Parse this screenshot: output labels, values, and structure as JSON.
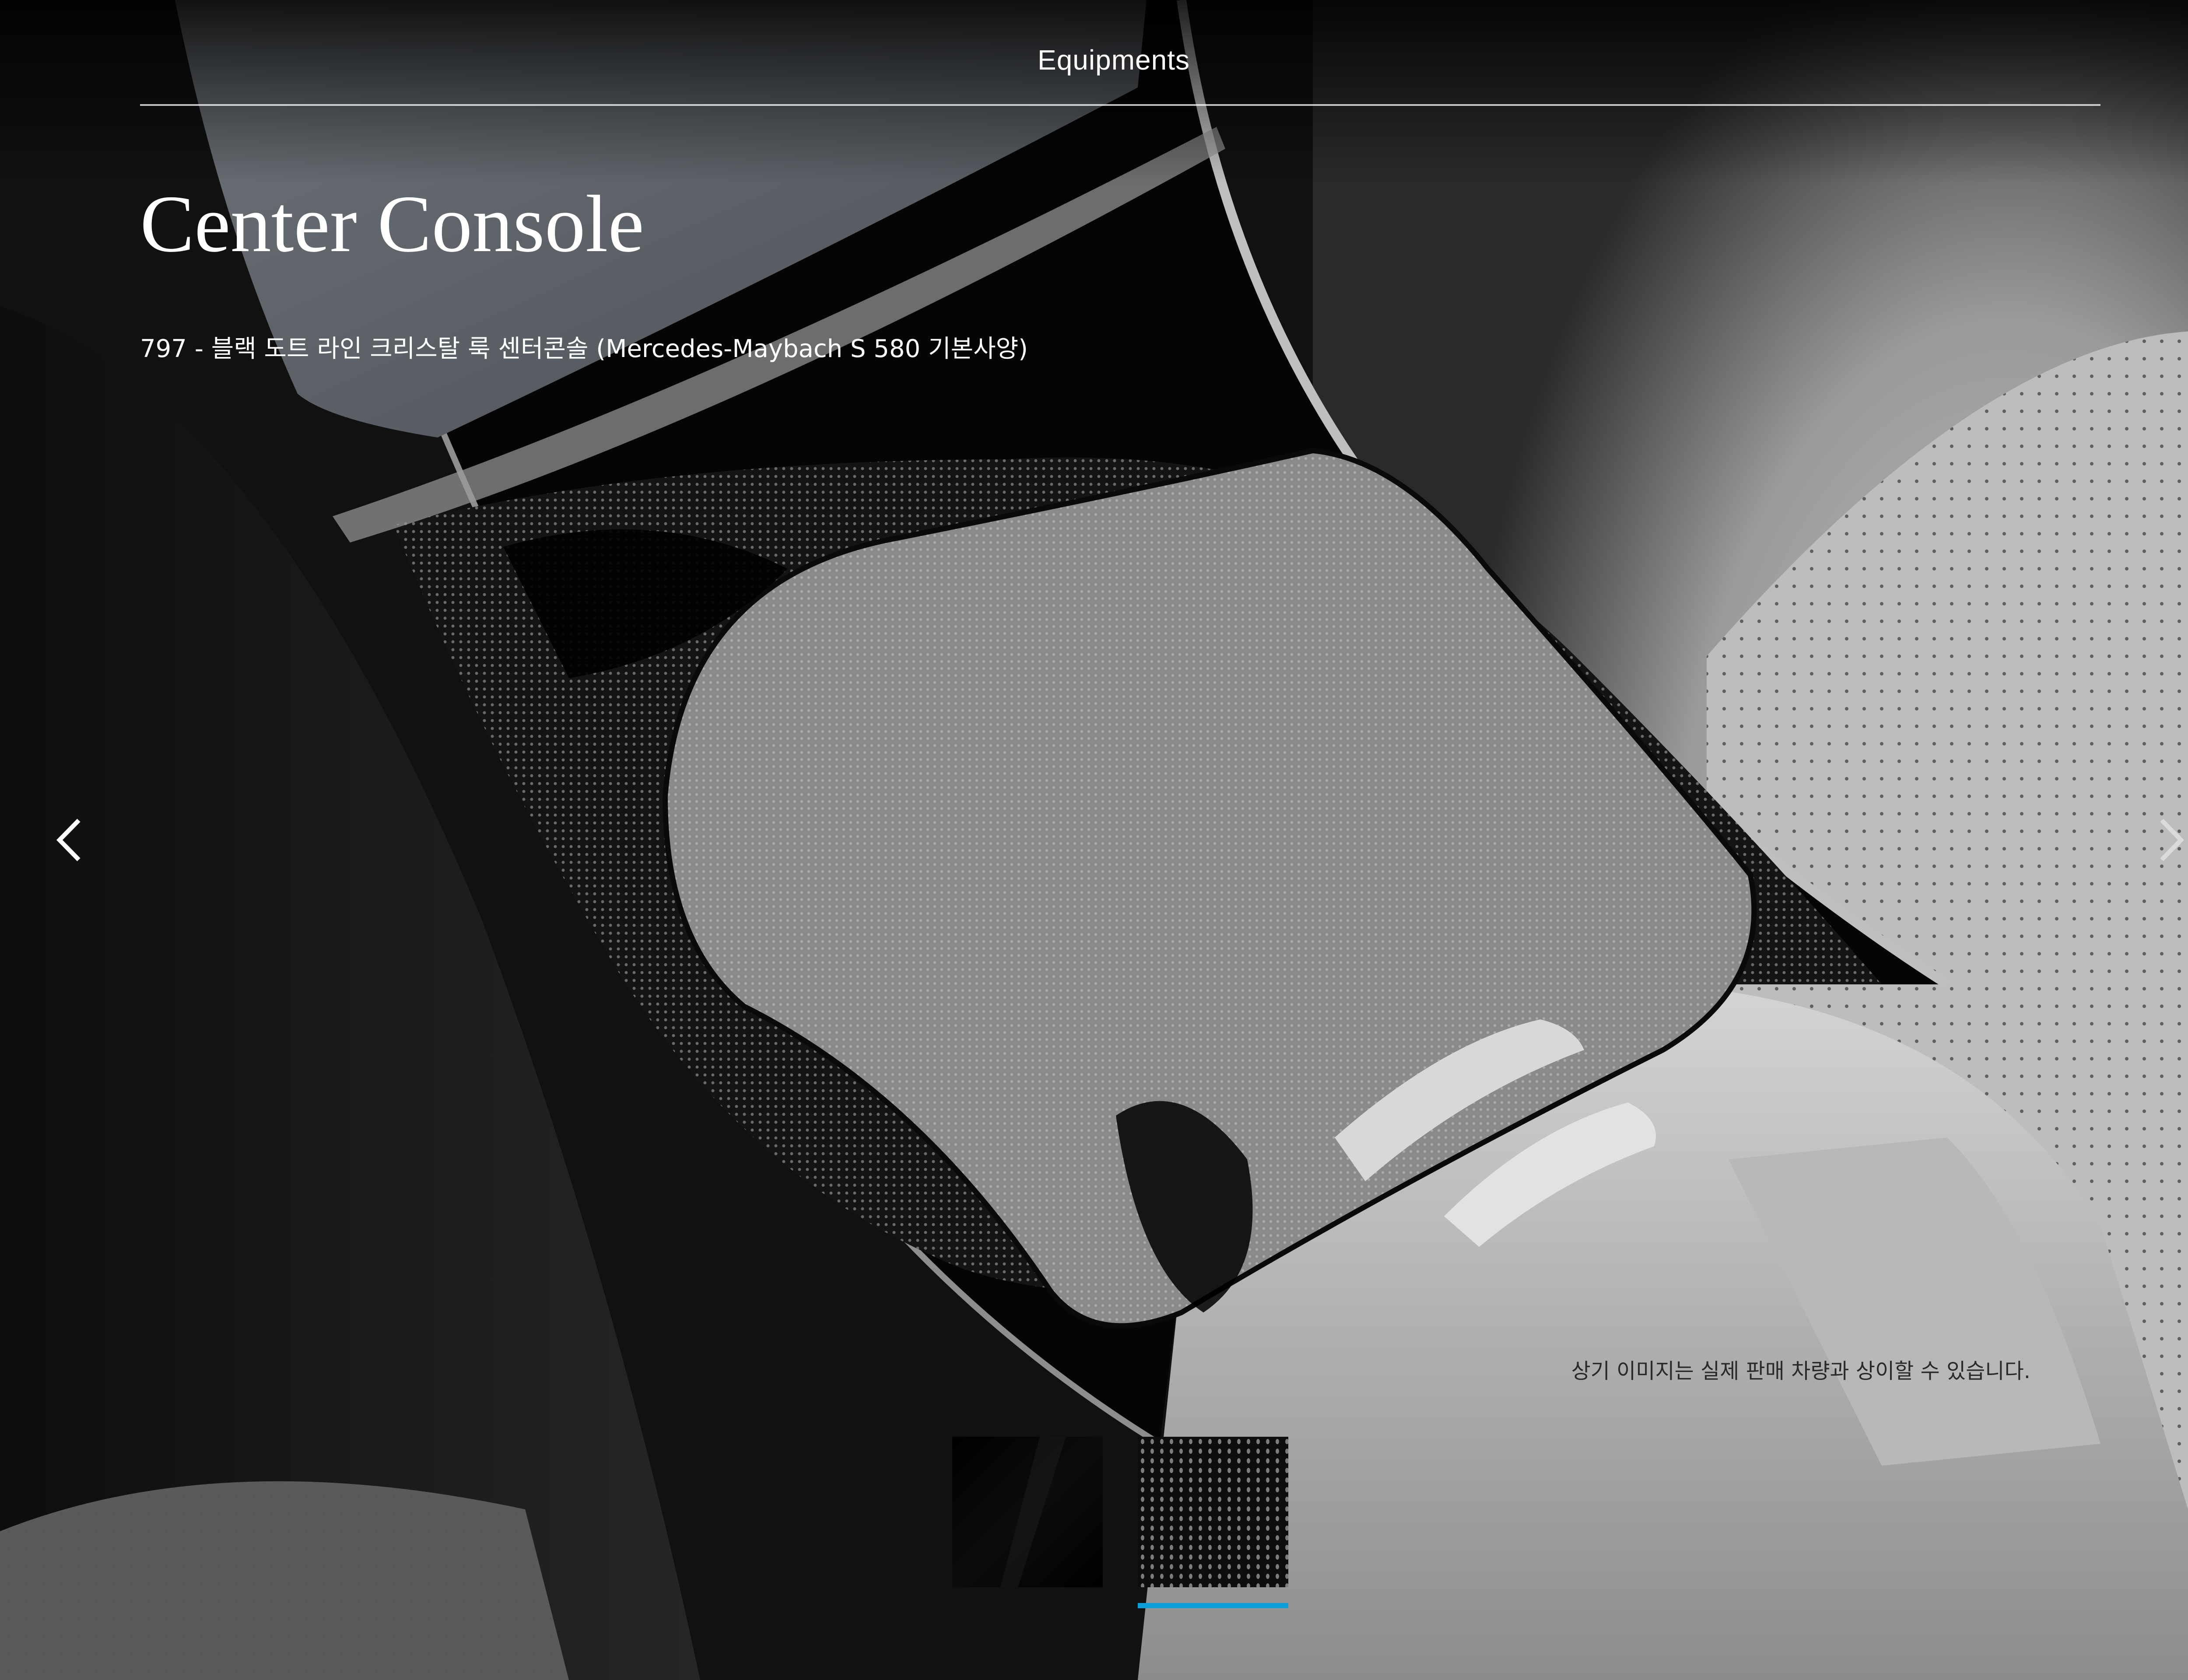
{
  "header": {
    "section_title": "Equipments"
  },
  "main": {
    "title": "Center Console",
    "option_description": "797 - 블랙 도트 라인 크리스탈 룩 센터콘솔 (Mercedes-Maybach S 580 기본사양)",
    "disclaimer": "상기 이미지는 실제 판매 차량과 상이할 수 있습니다."
  },
  "carousel": {
    "prev_icon": "chevron-left-icon",
    "next_icon": "chevron-right-icon"
  },
  "swatches": {
    "items": [
      {
        "name": "black-gloss-swatch",
        "selected": false
      },
      {
        "name": "black-dot-line-swatch",
        "selected": true
      }
    ],
    "indicator_color": "#0a9fd8"
  },
  "colors": {
    "text": "#ffffff",
    "accent": "#0a9fd8",
    "background": "#000000"
  }
}
